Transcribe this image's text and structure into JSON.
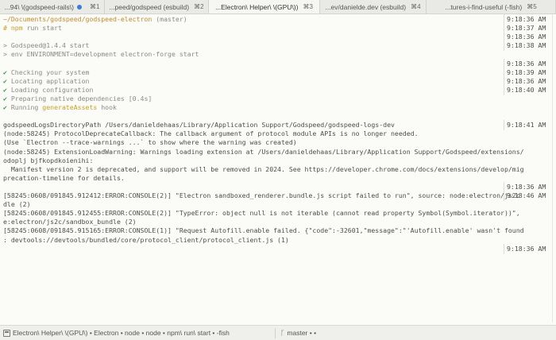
{
  "tabs": [
    {
      "label": "...94\\ \\(godspeed-rails\\)",
      "shortcut": "⌘1",
      "indicator": true,
      "active": false
    },
    {
      "label": "...peed/godspeed (esbuild)",
      "shortcut": "⌘2",
      "indicator": false,
      "active": false
    },
    {
      "label": "...Electron\\ Helper\\ \\(GPU\\))",
      "shortcut": "⌘3",
      "indicator": false,
      "active": true
    },
    {
      "label": "...ev/danielde.dev (esbuild)",
      "shortcut": "⌘4",
      "indicator": false,
      "active": false
    },
    {
      "label": "...tures-i-find-useful (-fish)",
      "shortcut": "⌘5",
      "indicator": false,
      "active": false
    }
  ],
  "terminal": {
    "lines": [
      {
        "segments": [
          {
            "text": "~/Documents/godspeed/godspeed-electron",
            "style": "path"
          },
          {
            "text": " (master)",
            "style": "dim"
          }
        ],
        "time": "9:18:36 AM"
      },
      {
        "segments": [
          {
            "text": "# ",
            "style": "yel"
          },
          {
            "text": "npm",
            "style": "yel"
          },
          {
            "text": " run start",
            "style": "dim"
          }
        ],
        "time": "9:18:37 AM"
      },
      {
        "segments": [
          {
            "text": "",
            "style": ""
          }
        ],
        "time": "9:18:36 AM"
      },
      {
        "segments": [
          {
            "text": "> ",
            "style": "gt"
          },
          {
            "text": "Godspeed@1.4.4 start",
            "style": "dim"
          }
        ],
        "time": "9:18:38 AM"
      },
      {
        "segments": [
          {
            "text": "> ",
            "style": "gt"
          },
          {
            "text": "env ENVIRONMENT=development electron-forge start",
            "style": "dim"
          }
        ],
        "time": ""
      },
      {
        "segments": [
          {
            "text": "",
            "style": ""
          }
        ],
        "time": "9:18:36 AM"
      },
      {
        "segments": [
          {
            "text": "✔ ",
            "style": "ok"
          },
          {
            "text": "Checking your system",
            "style": "dim"
          }
        ],
        "time": "9:18:39 AM"
      },
      {
        "segments": [
          {
            "text": "✔ ",
            "style": "ok"
          },
          {
            "text": "Locating application",
            "style": "dim"
          }
        ],
        "time": "9:18:36 AM"
      },
      {
        "segments": [
          {
            "text": "✔ ",
            "style": "ok"
          },
          {
            "text": "Loading configuration",
            "style": "dim"
          }
        ],
        "time": "9:18:40 AM"
      },
      {
        "segments": [
          {
            "text": "✔ ",
            "style": "ok"
          },
          {
            "text": "Preparing native dependencies ",
            "style": "dim"
          },
          {
            "text": "[0.4s]",
            "style": "gt"
          }
        ],
        "time": ""
      },
      {
        "segments": [
          {
            "text": "✔ ",
            "style": "ok"
          },
          {
            "text": "Running ",
            "style": "dim"
          },
          {
            "text": "generateAssets",
            "style": "yel"
          },
          {
            "text": " hook",
            "style": "dim"
          }
        ],
        "time": ""
      },
      {
        "segments": [
          {
            "text": "",
            "style": ""
          }
        ],
        "time": ""
      },
      {
        "segments": [
          {
            "text": "godspeedLogsDirectoryPath /Users/danieldehaas/Library/Application Support/Godspeed/godspeed-logs-dev",
            "style": ""
          }
        ],
        "time": "9:18:41 AM"
      },
      {
        "segments": [
          {
            "text": "(node:58245) ProtocolDeprecateCallback: The callback argument of protocol module APIs is no longer needed.",
            "style": ""
          }
        ],
        "time": ""
      },
      {
        "segments": [
          {
            "text": "(Use `Electron --trace-warnings ...` to show where the warning was created)",
            "style": ""
          }
        ],
        "time": ""
      },
      {
        "segments": [
          {
            "text": "(node:58245) ExtensionLoadWarning: Warnings loading extension at /Users/danieldehaas/Library/Application Support/Godspeed/extensions/",
            "style": ""
          }
        ],
        "time": ""
      },
      {
        "segments": [
          {
            "text": "odoplj bjfkopdkoienihi:",
            "style": ""
          }
        ],
        "time": ""
      },
      {
        "segments": [
          {
            "text": "  Manifest version 2 is deprecated, and support will be removed in 2024. See https://developer.chrome.com/docs/extensions/develop/mig",
            "style": ""
          }
        ],
        "time": ""
      },
      {
        "segments": [
          {
            "text": "precation-timeline for details.",
            "style": ""
          }
        ],
        "time": ""
      },
      {
        "segments": [
          {
            "text": "",
            "style": ""
          }
        ],
        "time": "9:18:36 AM"
      },
      {
        "segments": [
          {
            "text": "[58245:0608/091845.912412:ERROR:CONSOLE(2)] \"Electron sandboxed_renderer.bundle.js script failed to run\", source: node:electron/js2c",
            "style": ""
          }
        ],
        "time": "9:18:46 AM"
      },
      {
        "segments": [
          {
            "text": "dle (2)",
            "style": ""
          }
        ],
        "time": ""
      },
      {
        "segments": [
          {
            "text": "[58245:0608/091845.912455:ERROR:CONSOLE(2)] \"TypeError: object null is not iterable (cannot read property Symbol(Symbol.iterator))\",",
            "style": ""
          }
        ],
        "time": ""
      },
      {
        "segments": [
          {
            "text": "e:electron/js2c/sandbox_bundle (2)",
            "style": ""
          }
        ],
        "time": ""
      },
      {
        "segments": [
          {
            "text": "[58245:0608/091845.915165:ERROR:CONSOLE(1)] \"Request Autofill.enable failed. {\"code\":-32601,\"message\":\"'Autofill.enable' wasn't found",
            "style": ""
          }
        ],
        "time": ""
      },
      {
        "segments": [
          {
            "text": ": devtools://devtools/bundled/core/protocol_client/protocol_client.js (1)",
            "style": ""
          }
        ],
        "time": ""
      },
      {
        "segments": [
          {
            "text": "",
            "style": ""
          }
        ],
        "time": "9:18:36 AM"
      }
    ]
  },
  "status": {
    "icon": "terminal-window-icon",
    "process": "Electron\\ Helper\\ \\(GPU\\) • Electron • node • node • npm\\ run\\ start • -fish",
    "branch_glyph": "ᚴ",
    "branch": "master • •"
  },
  "colors": {
    "background": "#fbfbf8",
    "path": "#c28b2c",
    "success": "#2e9a3f",
    "accent": "#c8a025",
    "tab_indicator": "#3d7dd8"
  }
}
